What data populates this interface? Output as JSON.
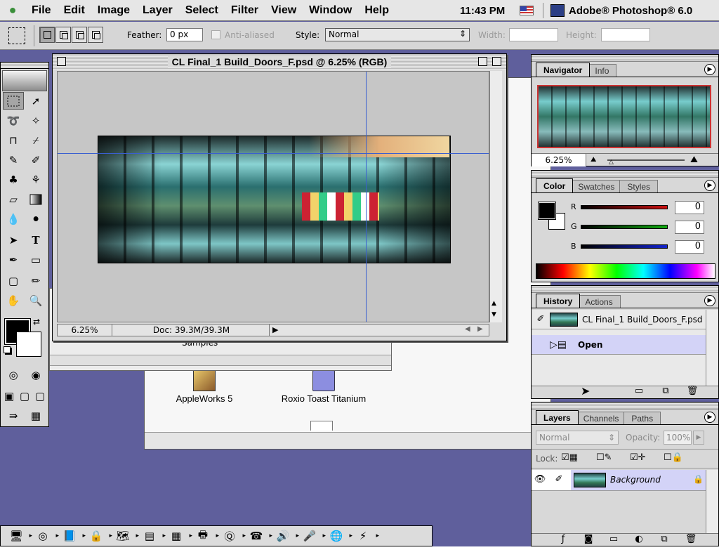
{
  "menubar": {
    "apple": "",
    "items": [
      "File",
      "Edit",
      "Image",
      "Layer",
      "Select",
      "Filter",
      "View",
      "Window",
      "Help"
    ],
    "clock": "11:43 PM",
    "app_name": "Adobe® Photoshop® 6.0"
  },
  "options": {
    "feather_label": "Feather:",
    "feather_value": "0 px",
    "antialiased_label": "Anti-aliased",
    "style_label": "Style:",
    "style_value": "Normal",
    "width_label": "Width:",
    "height_label": "Height:"
  },
  "document": {
    "title": "CL Final_1 Build_Doors_F.psd @ 6.25% (RGB)",
    "zoom": "6.25%",
    "doc_info": "Doc: 39.3M/39.3M"
  },
  "finder": {
    "partial_label": "Samples",
    "icons": [
      {
        "label": "AppleWorks 5"
      },
      {
        "label": "Roxio Toast Titanium"
      }
    ]
  },
  "navigator": {
    "tabs": [
      "Navigator",
      "Info"
    ],
    "zoom": "6.25%"
  },
  "color": {
    "tabs": [
      "Color",
      "Swatches",
      "Styles"
    ],
    "channels": [
      {
        "label": "R",
        "value": "0",
        "color": "#cc1111"
      },
      {
        "label": "G",
        "value": "0",
        "color": "#11aa11"
      },
      {
        "label": "B",
        "value": "0",
        "color": "#1122cc"
      }
    ]
  },
  "history": {
    "tabs": [
      "History",
      "Actions"
    ],
    "snapshot": "CL Final_1 Build_Doors_F.psd",
    "states": [
      "Open"
    ]
  },
  "layers": {
    "tabs": [
      "Layers",
      "Channels",
      "Paths"
    ],
    "blend_mode": "Normal",
    "opacity_label": "Opacity:",
    "opacity_value": "100%",
    "lock_label": "Lock:",
    "layer_name": "Background"
  },
  "colors": {
    "desktop": "#5f5f9c",
    "guide": "#3a5fd0",
    "selection_highlight": "#d3d3f7"
  }
}
